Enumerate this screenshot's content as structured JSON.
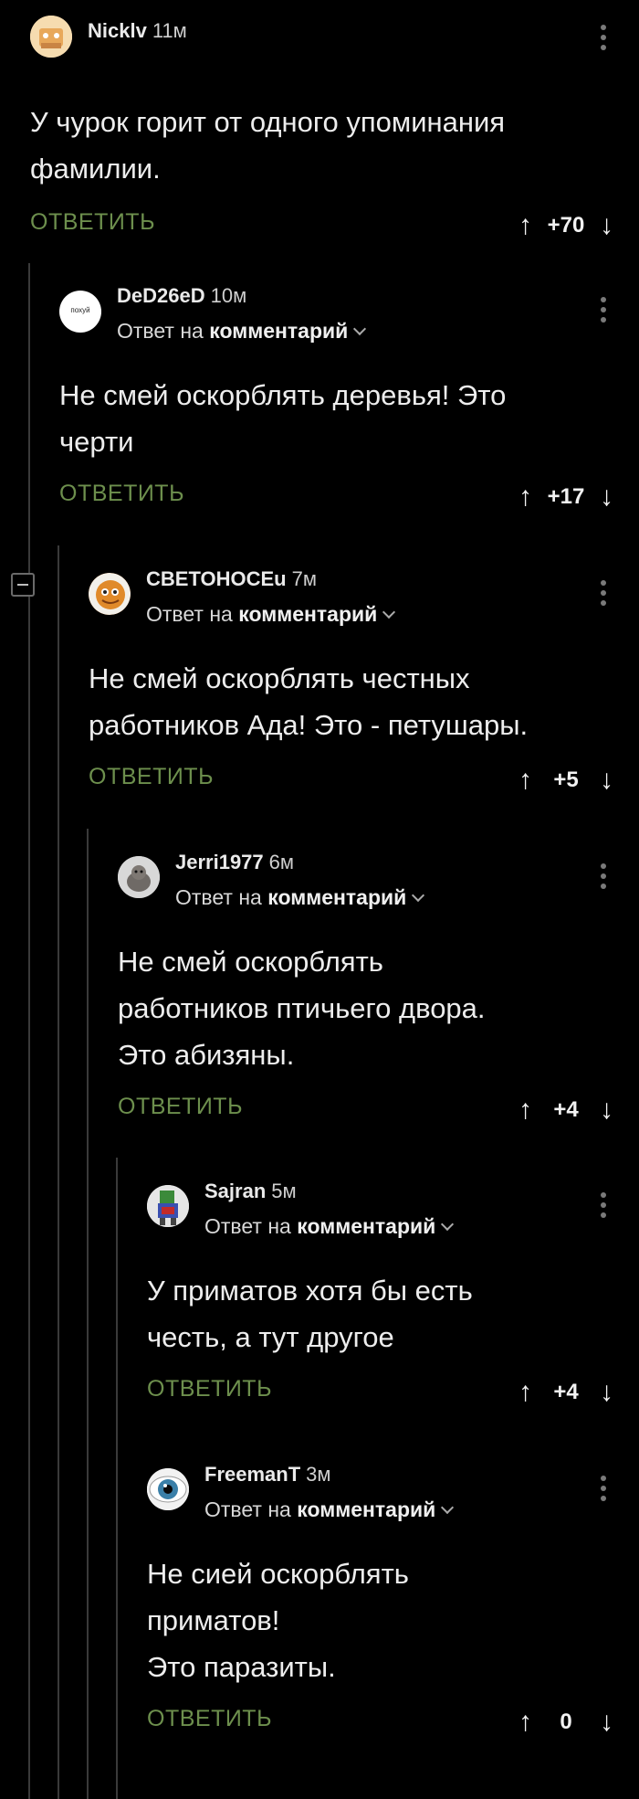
{
  "comments": [
    {
      "author": "Nicklv",
      "time": "11м",
      "reply_prefix": "",
      "reply_target": "",
      "text": "У чурок горит от одного упоминания\nфамилии.",
      "reply_label": "ОТВЕТИТЬ",
      "score": "+70"
    },
    {
      "author": "DeD26eD",
      "time": "10м",
      "reply_prefix": "Ответ на",
      "reply_target": "комментарий",
      "avatar_text": "похуй",
      "text": "Не смей оскорблять деревья! Это\nчерти",
      "reply_label": "ОТВЕТИТЬ",
      "score": "+17"
    },
    {
      "author": "CBETOHOCEu",
      "time": "7м",
      "reply_prefix": "Ответ на",
      "reply_target": "комментарий",
      "text": "Не смей оскорблять честных\nработников Ада! Это - петушары.",
      "reply_label": "ОТВЕТИТЬ",
      "score": "+5"
    },
    {
      "author": "Jerri1977",
      "time": "6м",
      "reply_prefix": "Ответ на",
      "reply_target": "комментарий",
      "text": "Не смей оскорблять\nработников птичьего двора.\nЭто абизяны.",
      "reply_label": "ОТВЕТИТЬ",
      "score": "+4"
    },
    {
      "author": "Sajran",
      "time": "5м",
      "reply_prefix": "Ответ на",
      "reply_target": "комментарий",
      "text": "У приматов хотя бы есть\nчесть, а тут другое",
      "reply_label": "ОТВЕТИТЬ",
      "score": "+4"
    },
    {
      "author": "FreemanT",
      "time": "3м",
      "reply_prefix": "Ответ на",
      "reply_target": "комментарий",
      "text": "Не сией оскорблять\nприматов!\nЭто паразиты.",
      "reply_label": "ОТВЕТИТЬ",
      "score": "0"
    }
  ],
  "icons": {
    "upvote": "arrow-up-icon",
    "downvote": "arrow-down-icon",
    "more": "more-vertical-icon",
    "collapse": "collapse-thread-icon"
  },
  "colors": {
    "background": "#000000",
    "reply_green": "#6d8f4d",
    "text": "#ededed",
    "thread_line": "#3a3a3a"
  }
}
